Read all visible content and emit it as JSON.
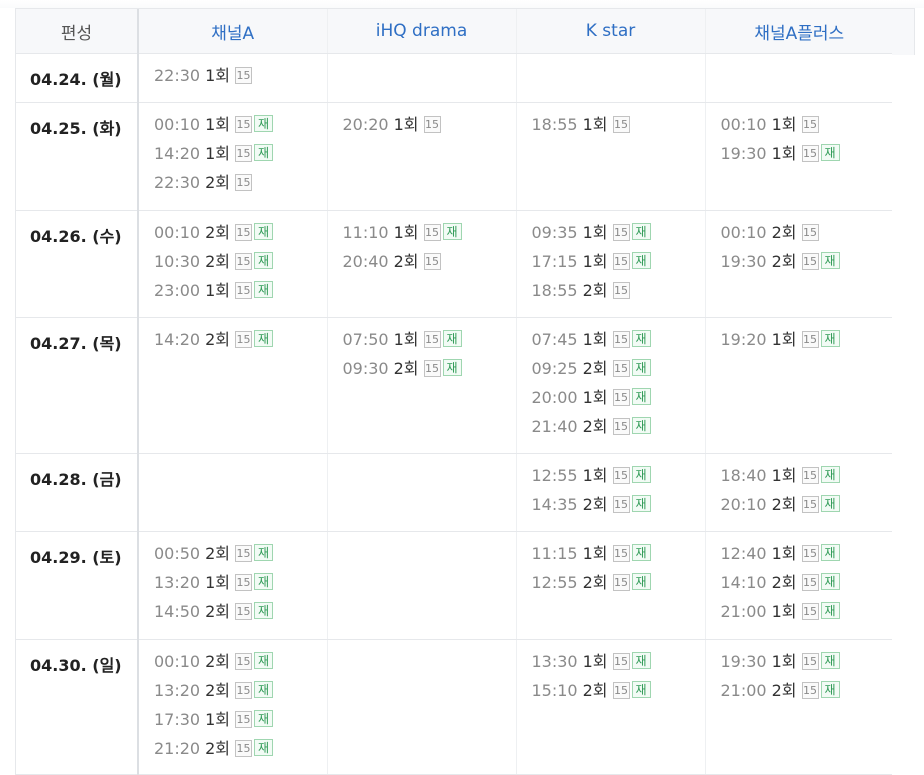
{
  "header": {
    "corner_label": "편성",
    "channels": [
      "채널A",
      "iHQ drama",
      "K star",
      "채널A플러스"
    ]
  },
  "rating_label": "15",
  "rerun_label": "재",
  "rows": [
    {
      "date": "04.24. (월)",
      "cells": [
        [
          {
            "time": "22:30",
            "ep": "1회",
            "rating": "15",
            "rerun": ""
          }
        ],
        [],
        [],
        []
      ]
    },
    {
      "date": "04.25. (화)",
      "cells": [
        [
          {
            "time": "00:10",
            "ep": "1회",
            "rating": "15",
            "rerun": "재"
          },
          {
            "time": "14:20",
            "ep": "1회",
            "rating": "15",
            "rerun": "재"
          },
          {
            "time": "22:30",
            "ep": "2회",
            "rating": "15",
            "rerun": ""
          }
        ],
        [
          {
            "time": "20:20",
            "ep": "1회",
            "rating": "15",
            "rerun": ""
          }
        ],
        [
          {
            "time": "18:55",
            "ep": "1회",
            "rating": "15",
            "rerun": ""
          }
        ],
        [
          {
            "time": "00:10",
            "ep": "1회",
            "rating": "15",
            "rerun": ""
          },
          {
            "time": "19:30",
            "ep": "1회",
            "rating": "15",
            "rerun": "재"
          }
        ]
      ]
    },
    {
      "date": "04.26. (수)",
      "cells": [
        [
          {
            "time": "00:10",
            "ep": "2회",
            "rating": "15",
            "rerun": "재"
          },
          {
            "time": "10:30",
            "ep": "2회",
            "rating": "15",
            "rerun": "재"
          },
          {
            "time": "23:00",
            "ep": "1회",
            "rating": "15",
            "rerun": "재"
          }
        ],
        [
          {
            "time": "11:10",
            "ep": "1회",
            "rating": "15",
            "rerun": "재"
          },
          {
            "time": "20:40",
            "ep": "2회",
            "rating": "15",
            "rerun": ""
          }
        ],
        [
          {
            "time": "09:35",
            "ep": "1회",
            "rating": "15",
            "rerun": "재"
          },
          {
            "time": "17:15",
            "ep": "1회",
            "rating": "15",
            "rerun": "재"
          },
          {
            "time": "18:55",
            "ep": "2회",
            "rating": "15",
            "rerun": ""
          }
        ],
        [
          {
            "time": "00:10",
            "ep": "2회",
            "rating": "15",
            "rerun": ""
          },
          {
            "time": "19:30",
            "ep": "2회",
            "rating": "15",
            "rerun": "재"
          }
        ]
      ]
    },
    {
      "date": "04.27. (목)",
      "cells": [
        [
          {
            "time": "14:20",
            "ep": "2회",
            "rating": "15",
            "rerun": "재"
          }
        ],
        [
          {
            "time": "07:50",
            "ep": "1회",
            "rating": "15",
            "rerun": "재"
          },
          {
            "time": "09:30",
            "ep": "2회",
            "rating": "15",
            "rerun": "재"
          }
        ],
        [
          {
            "time": "07:45",
            "ep": "1회",
            "rating": "15",
            "rerun": "재"
          },
          {
            "time": "09:25",
            "ep": "2회",
            "rating": "15",
            "rerun": "재"
          },
          {
            "time": "20:00",
            "ep": "1회",
            "rating": "15",
            "rerun": "재"
          },
          {
            "time": "21:40",
            "ep": "2회",
            "rating": "15",
            "rerun": "재"
          }
        ],
        [
          {
            "time": "19:20",
            "ep": "1회",
            "rating": "15",
            "rerun": "재"
          }
        ]
      ]
    },
    {
      "date": "04.28. (금)",
      "cells": [
        [],
        [],
        [
          {
            "time": "12:55",
            "ep": "1회",
            "rating": "15",
            "rerun": "재"
          },
          {
            "time": "14:35",
            "ep": "2회",
            "rating": "15",
            "rerun": "재"
          }
        ],
        [
          {
            "time": "18:40",
            "ep": "1회",
            "rating": "15",
            "rerun": "재"
          },
          {
            "time": "20:10",
            "ep": "2회",
            "rating": "15",
            "rerun": "재"
          }
        ]
      ]
    },
    {
      "date": "04.29. (토)",
      "cells": [
        [
          {
            "time": "00:50",
            "ep": "2회",
            "rating": "15",
            "rerun": "재"
          },
          {
            "time": "13:20",
            "ep": "1회",
            "rating": "15",
            "rerun": "재"
          },
          {
            "time": "14:50",
            "ep": "2회",
            "rating": "15",
            "rerun": "재"
          }
        ],
        [],
        [
          {
            "time": "11:15",
            "ep": "1회",
            "rating": "15",
            "rerun": "재"
          },
          {
            "time": "12:55",
            "ep": "2회",
            "rating": "15",
            "rerun": "재"
          }
        ],
        [
          {
            "time": "12:40",
            "ep": "1회",
            "rating": "15",
            "rerun": "재"
          },
          {
            "time": "14:10",
            "ep": "2회",
            "rating": "15",
            "rerun": "재"
          },
          {
            "time": "21:00",
            "ep": "1회",
            "rating": "15",
            "rerun": "재"
          }
        ]
      ]
    },
    {
      "date": "04.30. (일)",
      "cells": [
        [
          {
            "time": "00:10",
            "ep": "2회",
            "rating": "15",
            "rerun": "재"
          },
          {
            "time": "13:20",
            "ep": "2회",
            "rating": "15",
            "rerun": "재"
          },
          {
            "time": "17:30",
            "ep": "1회",
            "rating": "15",
            "rerun": "재"
          },
          {
            "time": "21:20",
            "ep": "2회",
            "rating": "15",
            "rerun": "재"
          }
        ],
        [],
        [
          {
            "time": "13:30",
            "ep": "1회",
            "rating": "15",
            "rerun": "재"
          },
          {
            "time": "15:10",
            "ep": "2회",
            "rating": "15",
            "rerun": "재"
          }
        ],
        [
          {
            "time": "19:30",
            "ep": "1회",
            "rating": "15",
            "rerun": "재"
          },
          {
            "time": "21:00",
            "ep": "2회",
            "rating": "15",
            "rerun": "재"
          }
        ]
      ]
    }
  ]
}
